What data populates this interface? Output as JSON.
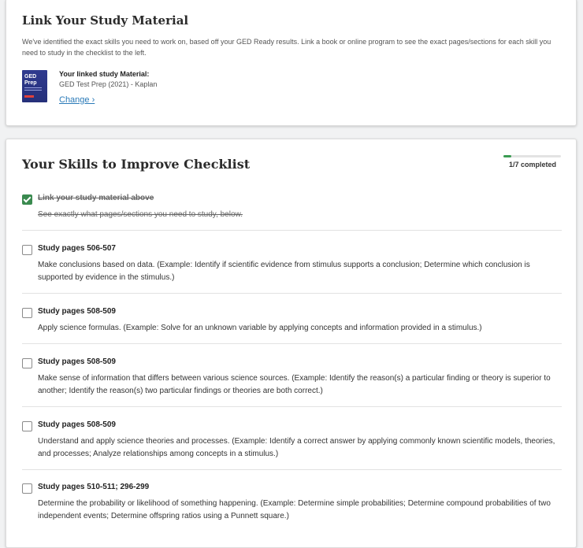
{
  "link_section": {
    "title": "Link Your Study Material",
    "description": "We've identified the exact skills you need to work on, based off your GED Ready results. Link a book or online program to see the exact pages/sections for each skill you need to study in the checklist to the left.",
    "linked_label": "Your linked study Material:",
    "linked_value": "GED Test Prep (2021) - Kaplan",
    "change_label": "Change ›",
    "book_cover_text": "GED Prep"
  },
  "checklist": {
    "title": "Your Skills to Improve Checklist",
    "progress_text": "1/7 completed",
    "progress_fraction": 0.143,
    "accent_color": "#3a9b52",
    "items": [
      {
        "title": "Link your study material above",
        "description": "See exactly what pages/sections you need to study, below.",
        "checked": true
      },
      {
        "title": "Study pages 506-507",
        "description": "Make conclusions based on data. (Example: Identify if scientific evidence from stimulus supports a conclusion; Determine which conclusion is supported by evidence in the stimulus.)",
        "checked": false
      },
      {
        "title": "Study pages 508-509",
        "description": "Apply science formulas. (Example: Solve for an unknown variable by applying concepts and information provided in a stimulus.)",
        "checked": false
      },
      {
        "title": "Study pages 508-509",
        "description": "Make sense of information that differs between various science sources. (Example: Identify the reason(s) a particular finding or theory is superior to another; Identify the reason(s) two particular findings or theories are both correct.)",
        "checked": false
      },
      {
        "title": "Study pages 508-509",
        "description": "Understand and apply science theories and processes. (Example: Identify a correct answer by applying commonly known scientific models, theories, and processes; Analyze relationships among concepts in a stimulus.)",
        "checked": false
      },
      {
        "title": "Study pages 510-511; 296-299",
        "description": "Determine the probability or likelihood of something happening. (Example: Determine simple probabilities; Determine compound probabilities of two independent events; Determine offspring ratios using a Punnett square.)",
        "checked": false
      }
    ]
  }
}
